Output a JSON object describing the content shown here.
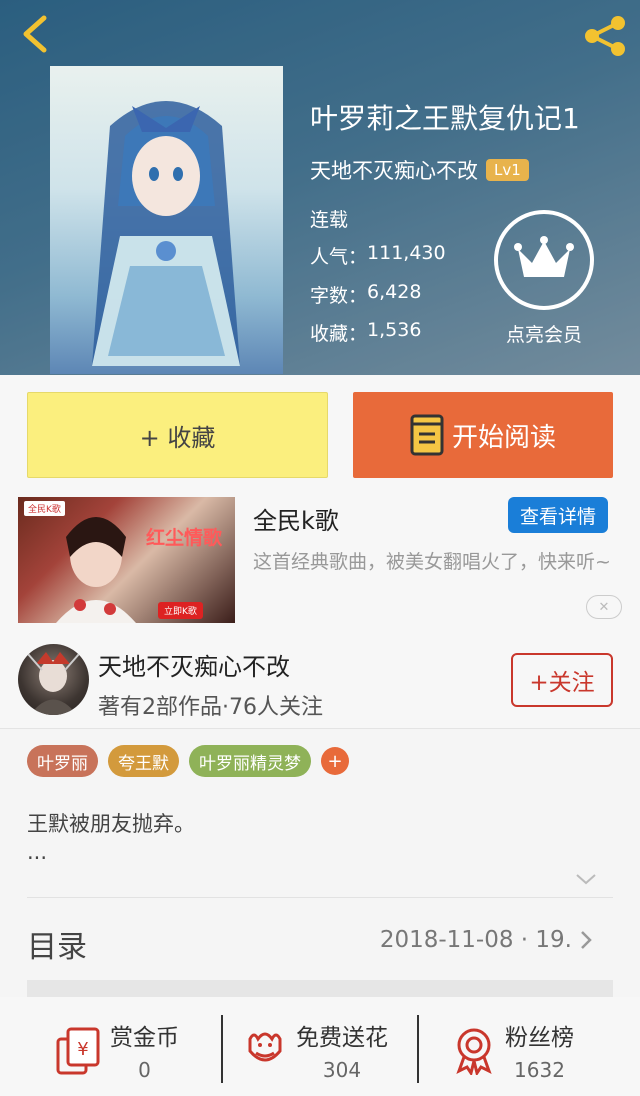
{
  "book": {
    "title": "叶罗莉之王默复仇记1",
    "author": "天地不灭痴心不改",
    "author_level": "Lv1",
    "status": "连载",
    "popularity_label": "人气：",
    "popularity": "111,430",
    "words_label": "字数：",
    "words": "6,428",
    "favorites_label": "收藏：",
    "favorites": "1,536",
    "vip_label": "点亮会员"
  },
  "actions": {
    "favorite_label": "+ 收藏",
    "read_label": "开始阅读"
  },
  "ad": {
    "image_logo": "全民K歌",
    "image_title": "红尘情歌",
    "image_cta": "立即K歌",
    "title": "全民k歌",
    "detail_label": "查看详情",
    "description": "这首经典歌曲，被美女翻唱火了，快来听~",
    "close_label": "✕"
  },
  "author_card": {
    "name": "天地不灭痴心不改",
    "meta": "著有2部作品·76人关注",
    "follow_label": "+关注"
  },
  "tags": [
    {
      "label": "叶罗丽",
      "color": "#c8735a"
    },
    {
      "label": "夸王默",
      "color": "#d39a3c"
    },
    {
      "label": "叶罗丽精灵梦",
      "color": "#8fb258"
    }
  ],
  "tag_add_label": "+",
  "description": {
    "text": "王默被朋友抛弃。",
    "more": "..."
  },
  "catalog": {
    "title": "目录",
    "latest": "2018-11-08 · 19."
  },
  "bottom_bar": [
    {
      "label": "赏金币",
      "value": "0",
      "icon": "red-envelope-icon"
    },
    {
      "label": "免费送花",
      "value": "304",
      "icon": "flower-icon"
    },
    {
      "label": "粉丝榜",
      "value": "1632",
      "icon": "medal-icon"
    }
  ],
  "colors": {
    "accent_orange": "#e86a3a",
    "favorite_yellow": "#fbef7e",
    "follow_red": "#c9372c",
    "icon_red": "#c9372c",
    "link_blue": "#1a7ed8"
  }
}
